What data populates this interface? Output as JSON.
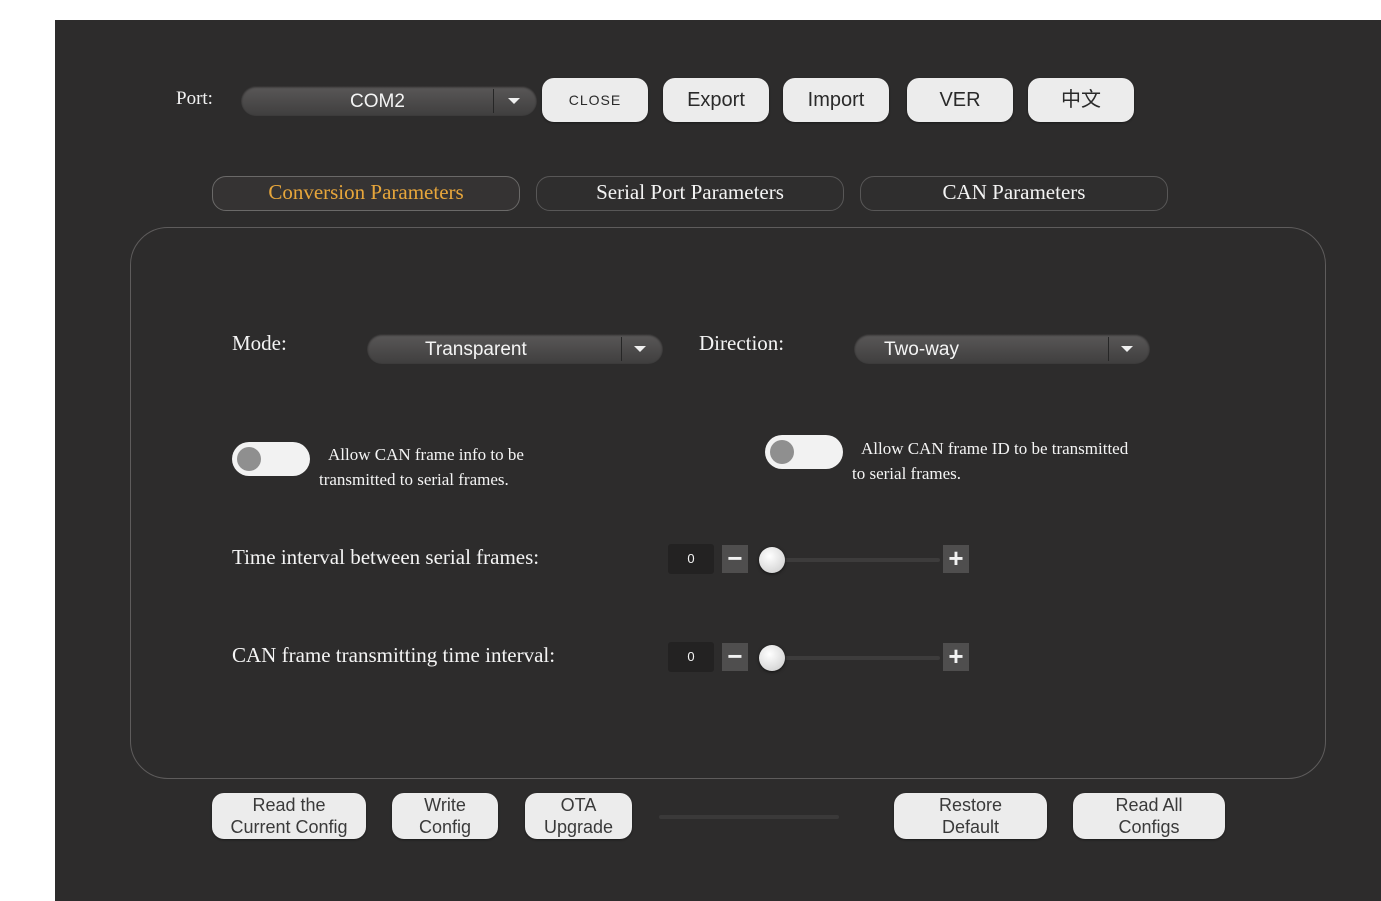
{
  "toolbar": {
    "port_label": "Port:",
    "port_value": "COM2",
    "close_label": "CLOSE",
    "export_label": "Export",
    "import_label": "Import",
    "ver_label": "VER",
    "lang_label": "中文"
  },
  "tabs": [
    {
      "label": "Conversion Parameters",
      "active": true
    },
    {
      "label": "Serial Port Parameters",
      "active": false
    },
    {
      "label": "CAN Parameters",
      "active": false
    }
  ],
  "conversion": {
    "mode_label": "Mode:",
    "mode_value": "Transparent",
    "direction_label": "Direction:",
    "direction_value": "Two-way",
    "toggle_frame_info": {
      "line1": "Allow CAN frame info to be",
      "line2": "transmitted to serial frames.",
      "on": false
    },
    "toggle_frame_id": {
      "line1": "Allow CAN frame ID to be transmitted",
      "line2": "to serial frames.",
      "on": false
    },
    "serial_interval": {
      "label": "Time interval between serial frames:",
      "value": "0",
      "minus": "−",
      "plus": "+"
    },
    "can_interval": {
      "label": "CAN frame transmitting time interval:",
      "value": "0",
      "minus": "−",
      "plus": "+"
    }
  },
  "bottom": {
    "read_current": {
      "line1": "Read the",
      "line2": "Current Config"
    },
    "write_config": {
      "line1": "Write",
      "line2": "Config"
    },
    "ota_upgrade": {
      "line1": "OTA",
      "line2": "Upgrade"
    },
    "restore_default": {
      "line1": "Restore",
      "line2": "Default"
    },
    "read_all": {
      "line1": "Read All",
      "line2": "Configs"
    },
    "progress": 0.0
  },
  "colors": {
    "background": "#2d2c2c",
    "active_tab_text": "#e7a63b",
    "button_face": "#ececec"
  }
}
